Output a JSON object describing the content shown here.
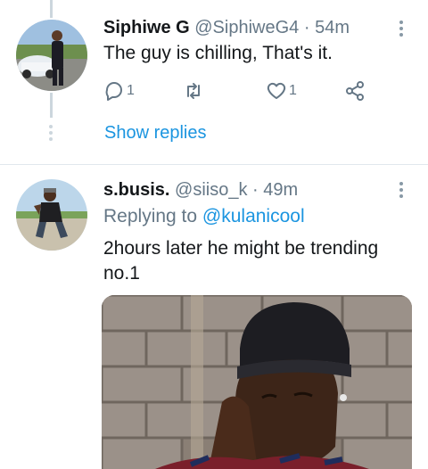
{
  "tweets": [
    {
      "name": "Siphiwe G",
      "handle": "@SiphiweG4",
      "separator": "·",
      "time": "54m",
      "text": "The guy is chilling, That's it.",
      "reply_count": "1",
      "retweet_count": "",
      "like_count": "1",
      "show_replies": "Show replies"
    },
    {
      "name": "s.busis.",
      "handle": "@siiso_k",
      "separator": "·",
      "time": "49m",
      "replying_to_label": "Replying to",
      "replying_to_handle": "@kulanicool",
      "text_line1": "2hours later he might be trending",
      "text_line2": "no.1"
    }
  ],
  "colors": {
    "accent": "#1b95e0",
    "secondary_text": "#657786",
    "divider": "#e1e8ed"
  },
  "icons": [
    "reply-icon",
    "retweet-icon",
    "like-icon",
    "share-icon",
    "more-icon"
  ]
}
